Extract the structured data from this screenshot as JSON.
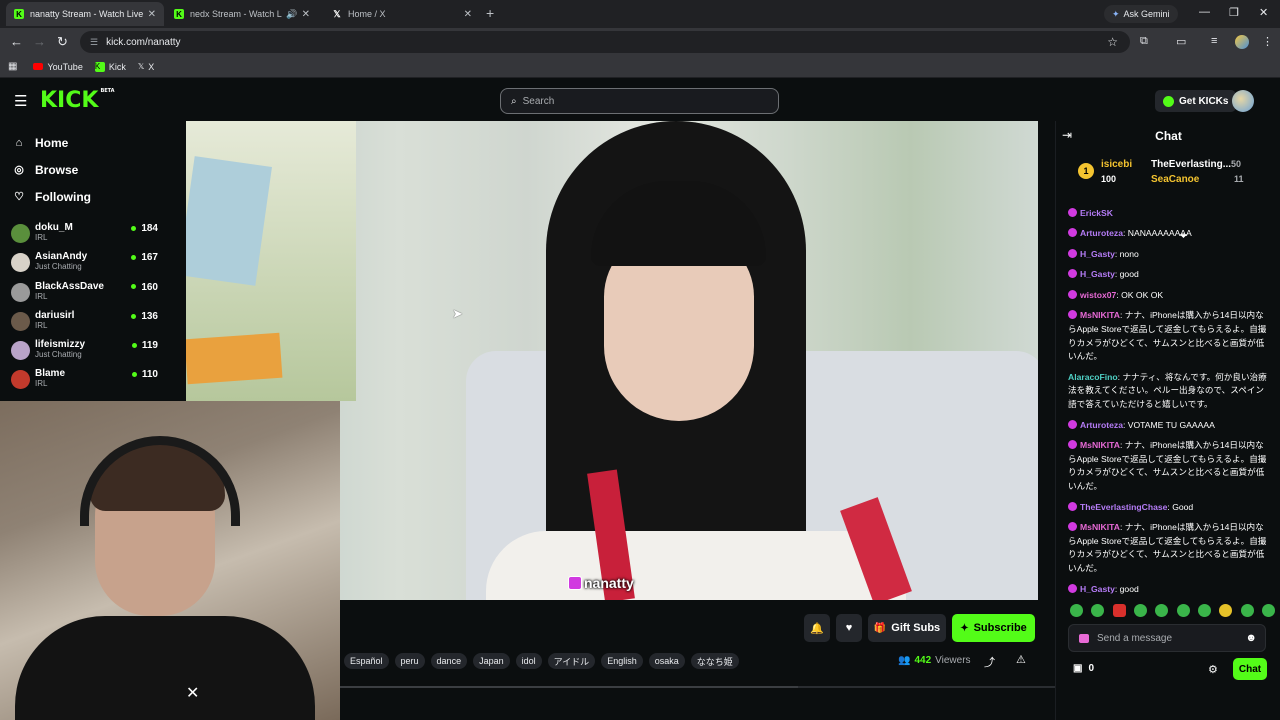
{
  "browser": {
    "tabs": [
      {
        "title": "nanatty Stream - Watch Live on",
        "active": true,
        "favicon": "kick-icon"
      },
      {
        "title": "nedx Stream - Watch Live o",
        "active": false,
        "favicon": "kick-icon",
        "audio": true
      },
      {
        "title": "Home / X",
        "active": false,
        "favicon": "x-icon"
      }
    ],
    "ask_gemini": "Ask Gemini",
    "url": "kick.com/nanatty",
    "bookmarks": [
      {
        "label": "YouTube",
        "icon": "youtube-icon"
      },
      {
        "label": "Kick",
        "icon": "kick-icon"
      },
      {
        "label": "X",
        "icon": "x-icon"
      }
    ]
  },
  "header": {
    "logo": "KICK",
    "logo_badge": "BETA",
    "search_placeholder": "Search",
    "get_kicks": "Get KICKs"
  },
  "sidebar": {
    "nav": [
      {
        "label": "Home",
        "icon": "home-icon"
      },
      {
        "label": "Browse",
        "icon": "compass-icon"
      },
      {
        "label": "Following",
        "icon": "heart-icon"
      }
    ],
    "channels": [
      {
        "name": "doku_M",
        "category": "IRL",
        "viewers": "184",
        "color": "#5a8f3c"
      },
      {
        "name": "AsianAndy",
        "category": "Just Chatting",
        "viewers": "167",
        "color": "#d8d2c8"
      },
      {
        "name": "BlackAssDave",
        "category": "IRL",
        "viewers": "160",
        "color": "#9a9a9a"
      },
      {
        "name": "dariusirl",
        "category": "IRL",
        "viewers": "136",
        "color": "#6b5a4a"
      },
      {
        "name": "lifeismizzy",
        "category": "Just Chatting",
        "viewers": "119",
        "color": "#b9a3c8"
      },
      {
        "name": "Blame",
        "category": "IRL",
        "viewers": "110",
        "color": "#c23a2c"
      }
    ]
  },
  "stream": {
    "watermark": "nanatty",
    "gift_subs": "Gift Subs",
    "subscribe": "Subscribe",
    "tags": [
      "Español",
      "peru",
      "dance",
      "Japan",
      "idol",
      "アイドル",
      "English",
      "osaka",
      "ななち姫"
    ],
    "viewers_count": "442",
    "viewers_label": "Viewers",
    "progress_fraction": 0.64
  },
  "chat": {
    "title": "Chat",
    "pinned": {
      "rank": "1",
      "user1": "isicebi",
      "user1_amount": "100",
      "user2": "TheEverlasting...",
      "user2_amount": "50",
      "user3": "SeaCanoe",
      "user3_amount": "11"
    },
    "messages": [
      {
        "user": "ErickSK",
        "text": "",
        "color": "u-purple",
        "badge": "bd"
      },
      {
        "user": "Arturoteza",
        "text": "NANAAAAAAAA",
        "color": "u-purple",
        "badge": "bd"
      },
      {
        "user": "H_Gasty",
        "text": "nono",
        "color": "u-purple",
        "badge": "bd"
      },
      {
        "user": "H_Gasty",
        "text": "good",
        "color": "u-purple",
        "badge": "bd"
      },
      {
        "user": "wistox07",
        "text": "OK OK OK",
        "color": "u-pink",
        "badge": "bd"
      },
      {
        "user": "MsNIKITA",
        "text": "ナナ、iPhoneは購入から14日以内ならApple Storeで返品して返金してもらえるよ。自撮りカメラがひどくて、サムスンと比べると画質が低いんだ。",
        "color": "u-pink",
        "badge": "bd"
      },
      {
        "user": "AlaracoFino",
        "text": "ナナティ、将なんです。何か良い治療法を教えてください。ペルー出身なので、スペイン語で答えていただけると嬉しいです。",
        "color": "u-teal",
        "badge": ""
      },
      {
        "user": "Arturoteza",
        "text": "VOTAME TU GAAAAA",
        "color": "u-purple",
        "badge": "bd"
      },
      {
        "user": "MsNIKITA",
        "text": "ナナ、iPhoneは購入から14日以内ならApple Storeで返品して返金してもらえるよ。自撮りカメラがひどくて、サムスンと比べると画質が低いんだ。",
        "color": "u-pink",
        "badge": "bd"
      },
      {
        "user": "TheEverlastingChase",
        "text": "Good",
        "color": "u-purple",
        "badge": "bd"
      },
      {
        "user": "MsNIKITA",
        "text": "ナナ、iPhoneは購入から14日以内ならApple Storeで返品して返金してもらえるよ。自撮りカメラがひどくて、サムスンと比べると画質が低いんだ。",
        "color": "u-pink",
        "badge": "bd"
      },
      {
        "user": "H_Gasty",
        "text": "good",
        "color": "u-purple",
        "badge": "bd"
      }
    ],
    "input_placeholder": "Send a message",
    "kicks_balance": "0",
    "chat_button": "Chat"
  },
  "colors": {
    "accent": "#53fc18",
    "background": "#0b0e0f"
  }
}
